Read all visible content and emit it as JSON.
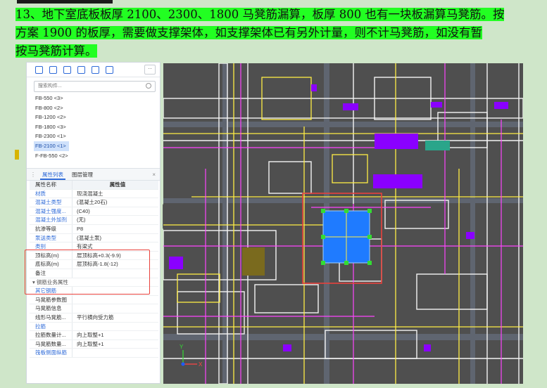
{
  "banner": {
    "lines": [
      "13、地下室底板板厚 2100、2300、1800 马凳筋漏算，板厚 800 也有一块板漏算马凳筋。按",
      "方案 1900 的板厚，需要做支撑架体，如支撑架体已有另外计量，则不计马凳筋，如没有暂",
      "按马凳筋计算。"
    ]
  },
  "component_panel": {
    "search_placeholder": "搜索构件...",
    "more_label": "··",
    "items": [
      "FB-550 <3>",
      "FB-800 <2>",
      "FB-1200 <2>",
      "FB-1800 <3>",
      "FB-2300 <1>",
      "FB-2100 <1>",
      "F-FB-550 <2>"
    ],
    "selected_index": 5
  },
  "property_panel": {
    "tab_properties": "属性列表",
    "tab_layers": "图层管理",
    "col_name": "属性名称",
    "col_value": "属性值",
    "rows": [
      {
        "k": "材质",
        "v": "现浇混凝土",
        "blue": true
      },
      {
        "k": "混凝土类型",
        "v": "(混凝土20石)",
        "blue": true
      },
      {
        "k": "混凝土强度...",
        "v": "(C40)",
        "blue": true
      },
      {
        "k": "混凝土外加剂",
        "v": "(无)",
        "blue": true
      },
      {
        "k": "抗渗等级",
        "v": "P8",
        "blue": false
      },
      {
        "k": "泵送类型",
        "v": "(混凝土泵)",
        "blue": true
      },
      {
        "k": "类别",
        "v": "有梁式",
        "blue": true
      },
      {
        "k": "顶标高(m)",
        "v": "层顶标高+0.3(-9.9)",
        "blue": false
      },
      {
        "k": "底标高(m)",
        "v": "层顶标高-1.8(-12)",
        "blue": false
      },
      {
        "k": "备注",
        "v": "",
        "blue": false
      }
    ],
    "group_label": "钢筋业务属性",
    "group_rows": [
      {
        "k": "其它钢筋",
        "v": "",
        "blue": true
      },
      {
        "k": "马凳筋参数图",
        "v": "",
        "blue": false
      },
      {
        "k": "马凳筋信息",
        "v": "",
        "blue": false
      },
      {
        "k": "线形马凳筋...",
        "v": "平行横向受力筋",
        "blue": false
      },
      {
        "k": "拉筋",
        "v": "",
        "blue": true
      },
      {
        "k": "拉筋数量计...",
        "v": "向上取整+1",
        "blue": false
      },
      {
        "k": "马凳筋数量...",
        "v": "向上取整+1",
        "blue": false
      },
      {
        "k": "筏板侧面纵筋",
        "v": "",
        "blue": true
      }
    ]
  },
  "viewport": {
    "axis_x": "X",
    "axis_y": "Y",
    "colors": {
      "background": "#4f4f4f",
      "wall": "#f4f4f4",
      "beam": "#ffee44",
      "pink": "#ff44ff",
      "purple": "#8a00ff",
      "slab": "#1f7bff",
      "marker": "#33dd33",
      "highlight": "#e8423c"
    }
  }
}
